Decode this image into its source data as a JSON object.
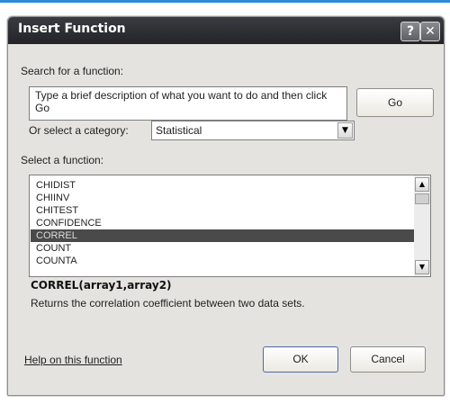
{
  "dialog": {
    "title": "Insert Function",
    "help_glyph": "?",
    "close_glyph": "✕"
  },
  "search": {
    "label": "Search for a function:",
    "value": "Type a brief description of what you want to do and then click Go",
    "go_label": "Go"
  },
  "category": {
    "label": "Or select a category:",
    "selected": "Statistical"
  },
  "functions": {
    "label": "Select a function:",
    "items": [
      "CHIDIST",
      "CHIINV",
      "CHITEST",
      "CONFIDENCE",
      "CORREL",
      "COUNT",
      "COUNTA"
    ],
    "selected": "CORREL",
    "signature": "CORREL(array1,array2)",
    "description": "Returns the correlation coefficient between two data sets."
  },
  "footer": {
    "help_link": "Help on this function",
    "ok_label": "OK",
    "cancel_label": "Cancel"
  },
  "icons": {
    "scroll_up": "▲",
    "scroll_down": "▼",
    "dropdown": "▼"
  },
  "colors": {
    "titlebar": "#2b2c30",
    "dialog_bg": "#e4e3df",
    "selection": "#4a4a4a",
    "top_accent": "#2b8bd8"
  }
}
